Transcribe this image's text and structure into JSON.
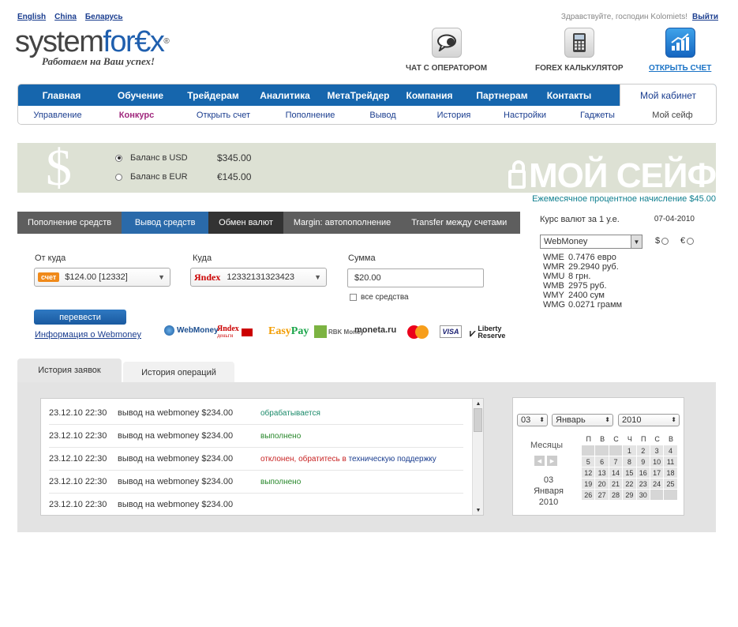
{
  "langs": [
    "English",
    "China",
    "Беларусь"
  ],
  "greeting": "Здравствуйте, господин Kolomiets!",
  "logout": "Выйти",
  "logo": {
    "text_a": "system",
    "text_b": "for",
    "text_c": "€x",
    "reg": "®",
    "slogan": "Работаем на Ваш успех!"
  },
  "tools": {
    "chat": "ЧАТ С ОПЕРАТОРОМ",
    "calc": "FOREX КАЛЬКУЛЯТОР",
    "open": "ОТКРЫТЬ СЧЕТ"
  },
  "nav": {
    "top": [
      "Главная",
      "Обучение",
      "Трейдерам",
      "Аналитика",
      "МетаТрейдер",
      "Компания",
      "Партнерам",
      "Контакты"
    ],
    "cabinet": "Мой кабинет",
    "sub": [
      "Управление",
      "Конкурс",
      "Открыть счет",
      "Пополнение",
      "Вывод",
      "История",
      "Настройки",
      "Гаджеты",
      "Мой сейф"
    ]
  },
  "balance": {
    "usd_label": "Баланс в USD",
    "usd_value": "$345.00",
    "eur_label": "Баланс в EUR",
    "eur_value": "€145.00",
    "safe_title": "МОЙ СЕЙФ",
    "interest": "Ежемесячное процентное начисление $45.00"
  },
  "op_tabs": [
    "Пополнение средств",
    "Вывод средств",
    "Обмен валют",
    "Margin: автопополнение",
    "Transfer между счетами"
  ],
  "form": {
    "from_label": "От куда",
    "from_badge": "счет",
    "from_value": "$124.00 [12332]",
    "to_label": "Куда",
    "to_brand": "Яndex",
    "to_value": "12332131323423",
    "sum_label": "Сумма",
    "sum_value": "$20.00",
    "all_funds": "все средства",
    "send": "перевести",
    "wm_info": "Информация о Webmoney"
  },
  "payments": {
    "wm": "WebMoney",
    "yd": "Яndex",
    "yd2": "деньги",
    "ep_a": "Easy",
    "ep_b": "Pay",
    "rbk": "RBK Money",
    "mon": "moneta.ru",
    "visa": "VISA",
    "lib_a": "Liberty",
    "lib_b": "Reserve"
  },
  "rates": {
    "title": "Курс валют за 1 у.е.",
    "date": "07-04-2010",
    "system": "WebMoney",
    "cur_usd": "$",
    "cur_eur": "€",
    "rows": [
      {
        "c": "WME",
        "v": "0.7476 евро"
      },
      {
        "c": "WMR",
        "v": "29.2940 руб."
      },
      {
        "c": "WMU",
        "v": "8 грн."
      },
      {
        "c": "WMB",
        "v": "2975 руб."
      },
      {
        "c": "WMY",
        "v": "2400 сум"
      },
      {
        "c": "WMG",
        "v": "0.0271 грамм"
      }
    ]
  },
  "history": {
    "tab_requests": "История заявок",
    "tab_ops": "История операций",
    "rows": [
      {
        "date": "23.12.10 22:30",
        "op": "вывод на webmoney $234.00",
        "status": "обрабатывается"
      },
      {
        "date": "23.12.10 22:30",
        "op": "вывод на webmoney $234.00",
        "status": "выполнено"
      },
      {
        "date": "23.12.10 22:30",
        "op": "вывод на webmoney $234.00",
        "status": "отклонен, обратитесь в ",
        "link": "техническую поддержку"
      },
      {
        "date": "23.12.10 22:30",
        "op": "вывод на webmoney $234.00",
        "status": "выполнено"
      },
      {
        "date": "23.12.10 22:30",
        "op": "вывод на webmoney $234.00",
        "status": ""
      }
    ]
  },
  "calendar": {
    "day": "03",
    "month": "Январь",
    "year": "2010",
    "months_label": "Месяцы",
    "sel_day": "03",
    "sel_month": "Января",
    "sel_year": "2010",
    "weekdays": [
      "П",
      "В",
      "С",
      "Ч",
      "П",
      "С",
      "В"
    ],
    "weeks": [
      [
        "",
        "",
        "",
        "1",
        "2",
        "3",
        "4"
      ],
      [
        "5",
        "6",
        "7",
        "8",
        "9",
        "10",
        "11"
      ],
      [
        "12",
        "13",
        "14",
        "15",
        "16",
        "17",
        "18"
      ],
      [
        "19",
        "20",
        "21",
        "22",
        "23",
        "24",
        "25"
      ],
      [
        "26",
        "27",
        "28",
        "29",
        "30",
        "",
        ""
      ]
    ]
  }
}
